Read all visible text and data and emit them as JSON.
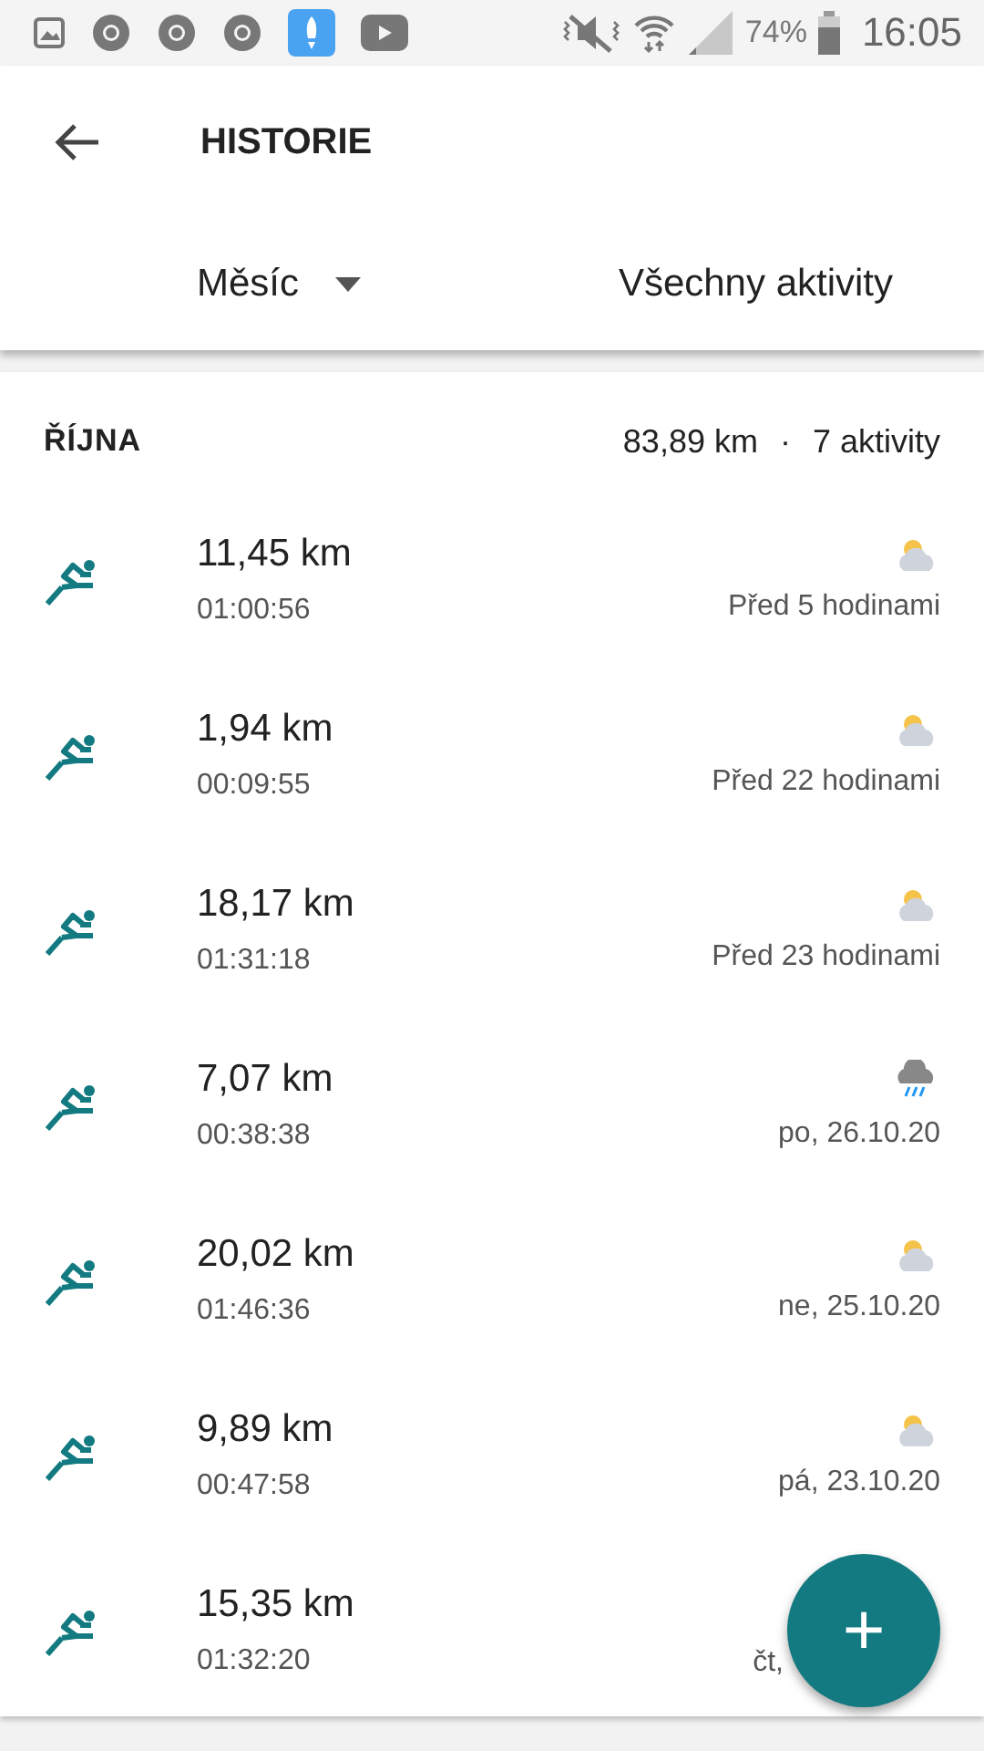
{
  "status_bar": {
    "battery": "74%",
    "time": "16:05"
  },
  "header": {
    "title": "HISTORIE",
    "period": "Měsíc",
    "filter": "Všechny aktivity"
  },
  "month": {
    "name": "ŘÍJNA",
    "distance": "83,89 km",
    "separator": "·",
    "count": "7 aktivity"
  },
  "activities": [
    {
      "distance": "11,45 km",
      "duration": "01:00:56",
      "kind": "partly_cloudy",
      "when": "Před 5 hodinami"
    },
    {
      "distance": "1,94 km",
      "duration": "00:09:55",
      "kind": "partly_cloudy",
      "when": "Před 22 hodinami"
    },
    {
      "distance": "18,17 km",
      "duration": "01:31:18",
      "kind": "partly_cloudy",
      "when": "Před 23 hodinami"
    },
    {
      "distance": "7,07 km",
      "duration": "00:38:38",
      "kind": "rain",
      "when": "po, 26.10.20"
    },
    {
      "distance": "20,02 km",
      "duration": "01:46:36",
      "kind": "partly_cloudy",
      "when": "ne, 25.10.20"
    },
    {
      "distance": "9,89 km",
      "duration": "00:47:58",
      "kind": "partly_cloudy",
      "when": "pá, 23.10.20"
    },
    {
      "distance": "15,35 km",
      "duration": "01:32:20",
      "kind": "covered",
      "when": "čt,"
    }
  ],
  "fab": {
    "label": "+"
  }
}
